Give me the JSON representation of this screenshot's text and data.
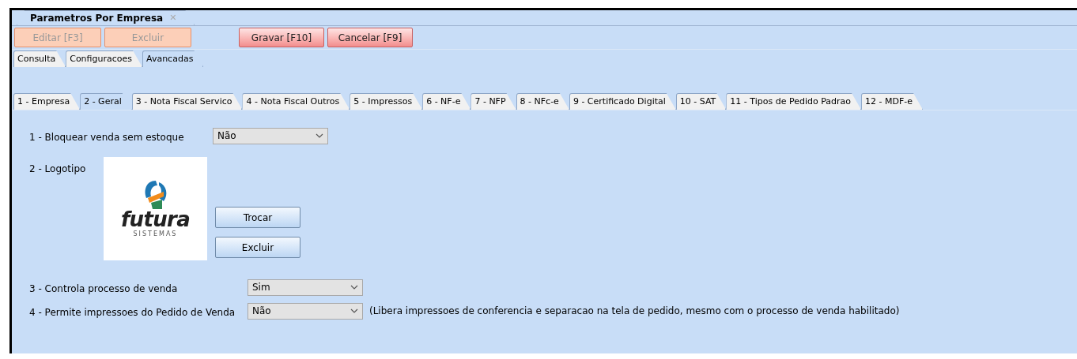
{
  "document_tab": {
    "title": "Parametros Por Empresa",
    "close": "✕"
  },
  "toolbar": [
    {
      "label": "Editar [F3]",
      "disabled": true
    },
    {
      "label": "Excluir",
      "disabled": true
    },
    {
      "label": "Gravar [F10]",
      "disabled": false
    },
    {
      "label": "Cancelar [F9]",
      "disabled": false
    }
  ],
  "view_tabs": [
    {
      "label": "Consulta",
      "selected": false
    },
    {
      "label": "Configuracoes",
      "selected": false
    },
    {
      "label": "Avancadas",
      "selected": true
    }
  ],
  "section_tabs": [
    {
      "label": "1 - Empresa",
      "selected": false
    },
    {
      "label": "2 - Geral",
      "selected": true
    },
    {
      "label": "3 - Nota Fiscal Servico",
      "selected": false
    },
    {
      "label": "4 - Nota Fiscal Outros",
      "selected": false
    },
    {
      "label": "5 - Impressos",
      "selected": false
    },
    {
      "label": "6 - NF-e",
      "selected": false
    },
    {
      "label": "7 - NFP",
      "selected": false
    },
    {
      "label": "8 - NFc-e",
      "selected": false
    },
    {
      "label": "9 - Certificado Digital",
      "selected": false
    },
    {
      "label": "10 - SAT",
      "selected": false
    },
    {
      "label": "11 - Tipos de Pedido Padrao",
      "selected": false
    },
    {
      "label": "12 - MDF-e",
      "selected": false
    }
  ],
  "fields": [
    {
      "kind": "select",
      "label": "1 - Bloquear venda sem estoque",
      "value": "Não"
    },
    {
      "kind": "logo",
      "label": "2 - Logotipo",
      "logo_name": "futura",
      "logo_tagline": "SISTEMAS",
      "buttons": [
        "Trocar",
        "Excluir"
      ]
    },
    {
      "kind": "select",
      "label": "3 - Controla processo de venda",
      "value": "Sim"
    },
    {
      "kind": "select",
      "label": "4 - Permite impressoes do Pedido de Venda",
      "value": "Não",
      "note": "(Libera impressoes de conferencia e separacao na tela de pedido, mesmo com o processo de venda habilitado)"
    }
  ]
}
